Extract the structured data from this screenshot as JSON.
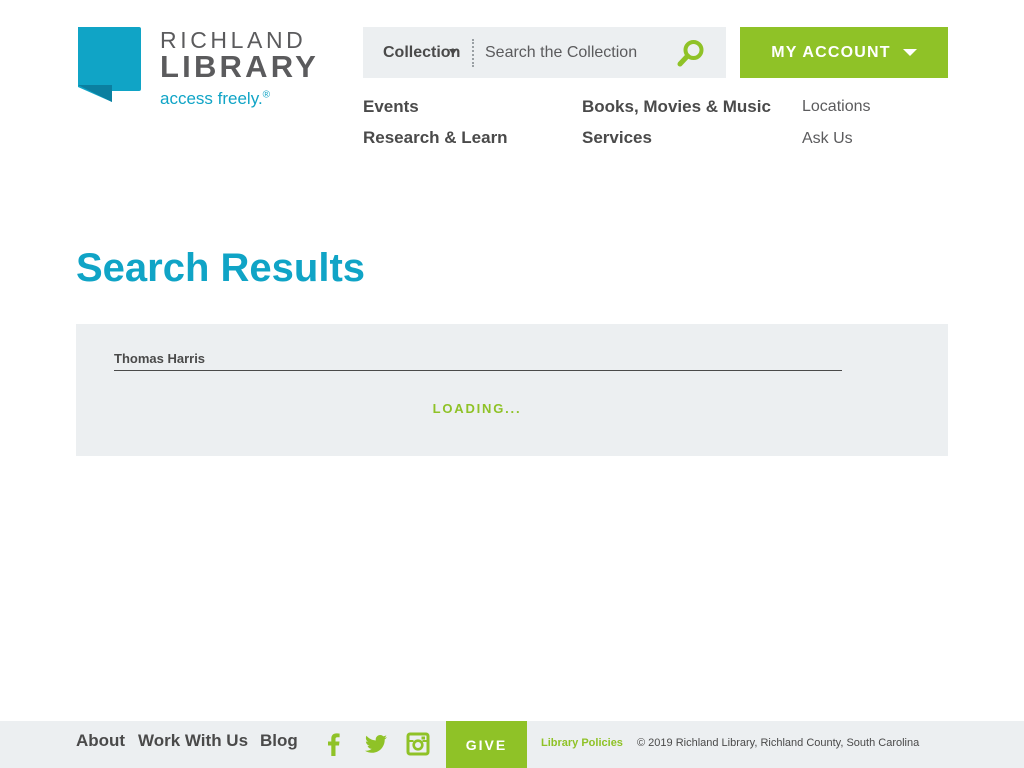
{
  "colors": {
    "brand_blue": "#10a4c6",
    "brand_green": "#8fc227",
    "panel_gray": "#eceff1",
    "text_dark": "#4a4a4a"
  },
  "header": {
    "logo": {
      "line1": "RICHLAND",
      "line2": "LIBRARY",
      "tagline": "access freely.",
      "tagline_mark": "®",
      "icon": "library-logo-mark-icon"
    },
    "search": {
      "collection_label": "Collection",
      "placeholder": "Search the Collection",
      "value": "",
      "button_icon": "search-icon"
    },
    "account": {
      "label": "MY ACCOUNT",
      "icon": "caret-down-icon"
    },
    "nav": {
      "events": "Events",
      "research": "Research & Learn",
      "books": "Books, Movies & Music",
      "services": "Services",
      "locations": "Locations",
      "ask_us": "Ask Us"
    }
  },
  "main": {
    "title": "Search Results",
    "query": "Thomas Harris",
    "status": "LOADING..."
  },
  "footer": {
    "links": {
      "about": "About",
      "work": "Work With Us",
      "blog": "Blog"
    },
    "social": [
      "facebook-icon",
      "twitter-icon",
      "instagram-icon"
    ],
    "give": "GIVE",
    "policies": "Library Policies",
    "copyright": "© 2019 Richland Library, Richland County, South Carolina"
  }
}
